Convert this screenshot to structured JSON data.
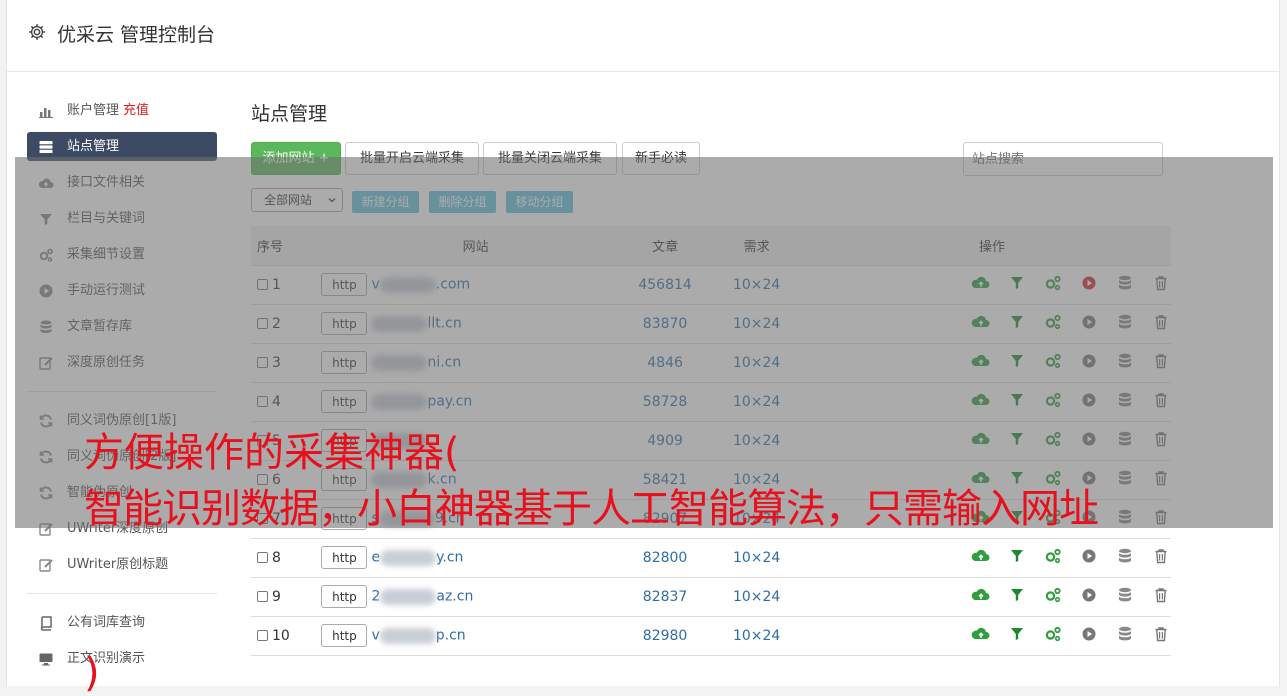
{
  "header": {
    "title": "优采云 管理控制台"
  },
  "sidebar": {
    "items": [
      {
        "label": "账户管理",
        "extra": "充值",
        "icon": "bar-chart-icon"
      },
      {
        "label": "站点管理",
        "icon": "server-icon",
        "active": true
      },
      {
        "label": "接口文件相关",
        "icon": "cloud-upload-icon"
      },
      {
        "label": "栏目与关键词",
        "icon": "filter-icon"
      },
      {
        "label": "采集细节设置",
        "icon": "cogs-icon"
      },
      {
        "label": "手动运行测试",
        "icon": "play-circle-icon"
      },
      {
        "label": "文章暂存库",
        "icon": "database-icon"
      },
      {
        "label": "深度原创任务",
        "icon": "edit-icon"
      }
    ],
    "items2": [
      {
        "label": "同义词伪原创[1版]",
        "icon": "refresh-icon"
      },
      {
        "label": "同义词伪原创[2版]",
        "icon": "refresh-icon"
      },
      {
        "label": "智能伪原创",
        "icon": "refresh-icon"
      },
      {
        "label": "UWriter深度原创",
        "icon": "edit-icon"
      },
      {
        "label": "UWriter原创标题",
        "icon": "edit-icon"
      }
    ],
    "items3": [
      {
        "label": "公有词库查询",
        "icon": "book-icon"
      },
      {
        "label": "正文识别演示",
        "icon": "monitor-icon"
      }
    ]
  },
  "main": {
    "title": "站点管理",
    "buttons": {
      "add": "添加网站 +",
      "batch_open": "批量开启云端采集",
      "batch_close": "批量关闭云端采集",
      "guide": "新手必读"
    },
    "search_placeholder": "站点搜索",
    "group_select": "全部网站",
    "group_buttons": {
      "new": "新建分组",
      "delete": "删除分组",
      "move": "移动分组"
    },
    "columns": [
      "序号",
      "网站",
      "文章",
      "需求",
      "操作"
    ],
    "rows": [
      {
        "no": "1",
        "prefix": "v",
        "suffix": ".com",
        "articles": "456814",
        "req": "10×24",
        "running": true
      },
      {
        "no": "2",
        "prefix": "",
        "suffix": "llt.cn",
        "articles": "83870",
        "req": "10×24",
        "running": false
      },
      {
        "no": "3",
        "prefix": "",
        "suffix": "ni.cn",
        "articles": "4846",
        "req": "10×24",
        "running": false
      },
      {
        "no": "4",
        "prefix": "",
        "suffix": "pay.cn",
        "articles": "58728",
        "req": "10×24",
        "running": false
      },
      {
        "no": "5",
        "prefix": "",
        "suffix": "",
        "articles": "4909",
        "req": "10×24",
        "running": false
      },
      {
        "no": "6",
        "prefix": "",
        "suffix": "k.cn",
        "articles": "58421",
        "req": "10×24",
        "running": false
      },
      {
        "no": "7",
        "prefix": "s",
        "suffix": "9.cn",
        "articles": "82907",
        "req": "10×24",
        "running": false
      },
      {
        "no": "8",
        "prefix": "e",
        "suffix": "y.cn",
        "articles": "82800",
        "req": "10×24",
        "running": false
      },
      {
        "no": "9",
        "prefix": "2",
        "suffix": "az.cn",
        "articles": "82837",
        "req": "10×24",
        "running": false
      },
      {
        "no": "10",
        "prefix": "v",
        "suffix": "p.cn",
        "articles": "82980",
        "req": "10×24",
        "running": false
      }
    ],
    "http_label": "http"
  },
  "caption": {
    "line1": "方便操作的采集神器(",
    "line2": "智能识别数据，小白神器基于人工智能算法，只需输入网址",
    "line3": ")"
  },
  "colors": {
    "accent": "#3c4a63",
    "green": "#5cb85c",
    "info": "#5bc0de",
    "caption": "#e8101c",
    "link": "#2e6da4"
  }
}
